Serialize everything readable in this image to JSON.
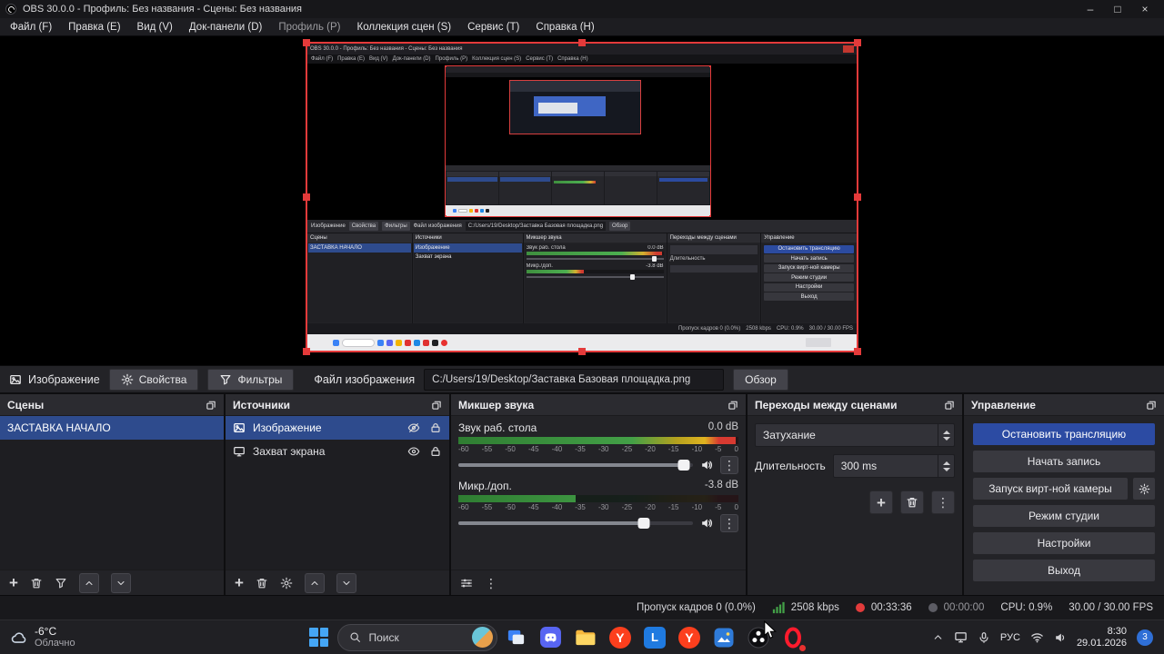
{
  "titlebar": {
    "title": "OBS 30.0.0 - Профиль: Без названия - Сцены: Без названия",
    "minimize": "–",
    "maximize": "□",
    "close": "×"
  },
  "menu": {
    "items": [
      {
        "label": "Файл (F)"
      },
      {
        "label": "Правка (E)"
      },
      {
        "label": "Вид (V)"
      },
      {
        "label": "Док-панели (D)"
      },
      {
        "label": "Профиль (P)"
      },
      {
        "label": "Коллекция сцен (S)"
      },
      {
        "label": "Сервис (T)"
      },
      {
        "label": "Справка (H)"
      }
    ]
  },
  "source_toolbar": {
    "source_type": "Изображение",
    "properties": "Свойства",
    "filters": "Фильтры",
    "file_label": "Файл изображения",
    "file_path": "C:/Users/19/Desktop/Заставка Базовая площадка.png",
    "browse": "Обзор"
  },
  "scenes": {
    "title": "Сцены",
    "items": [
      {
        "label": "ЗАСТАВКА НАЧАЛО",
        "selected": true
      }
    ]
  },
  "sources": {
    "title": "Источники",
    "items": [
      {
        "label": "Изображение",
        "type": "image",
        "visible": false,
        "locked": true,
        "selected": true
      },
      {
        "label": "Захват экрана",
        "type": "display-capture",
        "visible": true,
        "locked": true,
        "selected": false
      }
    ]
  },
  "mixer": {
    "title": "Микшер звука",
    "scale_ticks": [
      "-60",
      "-55",
      "-50",
      "-45",
      "-40",
      "-35",
      "-30",
      "-25",
      "-20",
      "-15",
      "-10",
      "-5",
      "0"
    ],
    "channels": [
      {
        "name": "Звук раб. стола",
        "db": "0.0 dB",
        "level_pct": 99,
        "slider_pct": 96
      },
      {
        "name": "Микр./доп.",
        "db": "-3.8 dB",
        "level_pct": 42,
        "slider_pct": 79
      }
    ]
  },
  "transitions": {
    "title": "Переходы между сценами",
    "current": "Затухание",
    "duration_label": "Длительность",
    "duration_value": "300 ms"
  },
  "controls": {
    "title": "Управление",
    "stop_stream": "Остановить трансляцию",
    "start_record": "Начать запись",
    "virtual_camera": "Запуск вирт-ной камеры",
    "studio_mode": "Режим студии",
    "settings": "Настройки",
    "exit": "Выход"
  },
  "status_bar": {
    "dropped_frames": "Пропуск кадров 0 (0.0%)",
    "bitrate": "2508 kbps",
    "stream_time": "00:33:36",
    "record_time": "00:00:00",
    "cpu": "CPU: 0.9%",
    "fps": "30.00 / 30.00 FPS"
  },
  "taskbar": {
    "weather_temp": "-6°C",
    "weather_desc": "Облачно",
    "search_placeholder": "Поиск",
    "yandex_letter": "Y",
    "l_letter": "L",
    "language": "РУС",
    "time": "8:30",
    "date": "29.01.2026",
    "notification_count": "3"
  }
}
